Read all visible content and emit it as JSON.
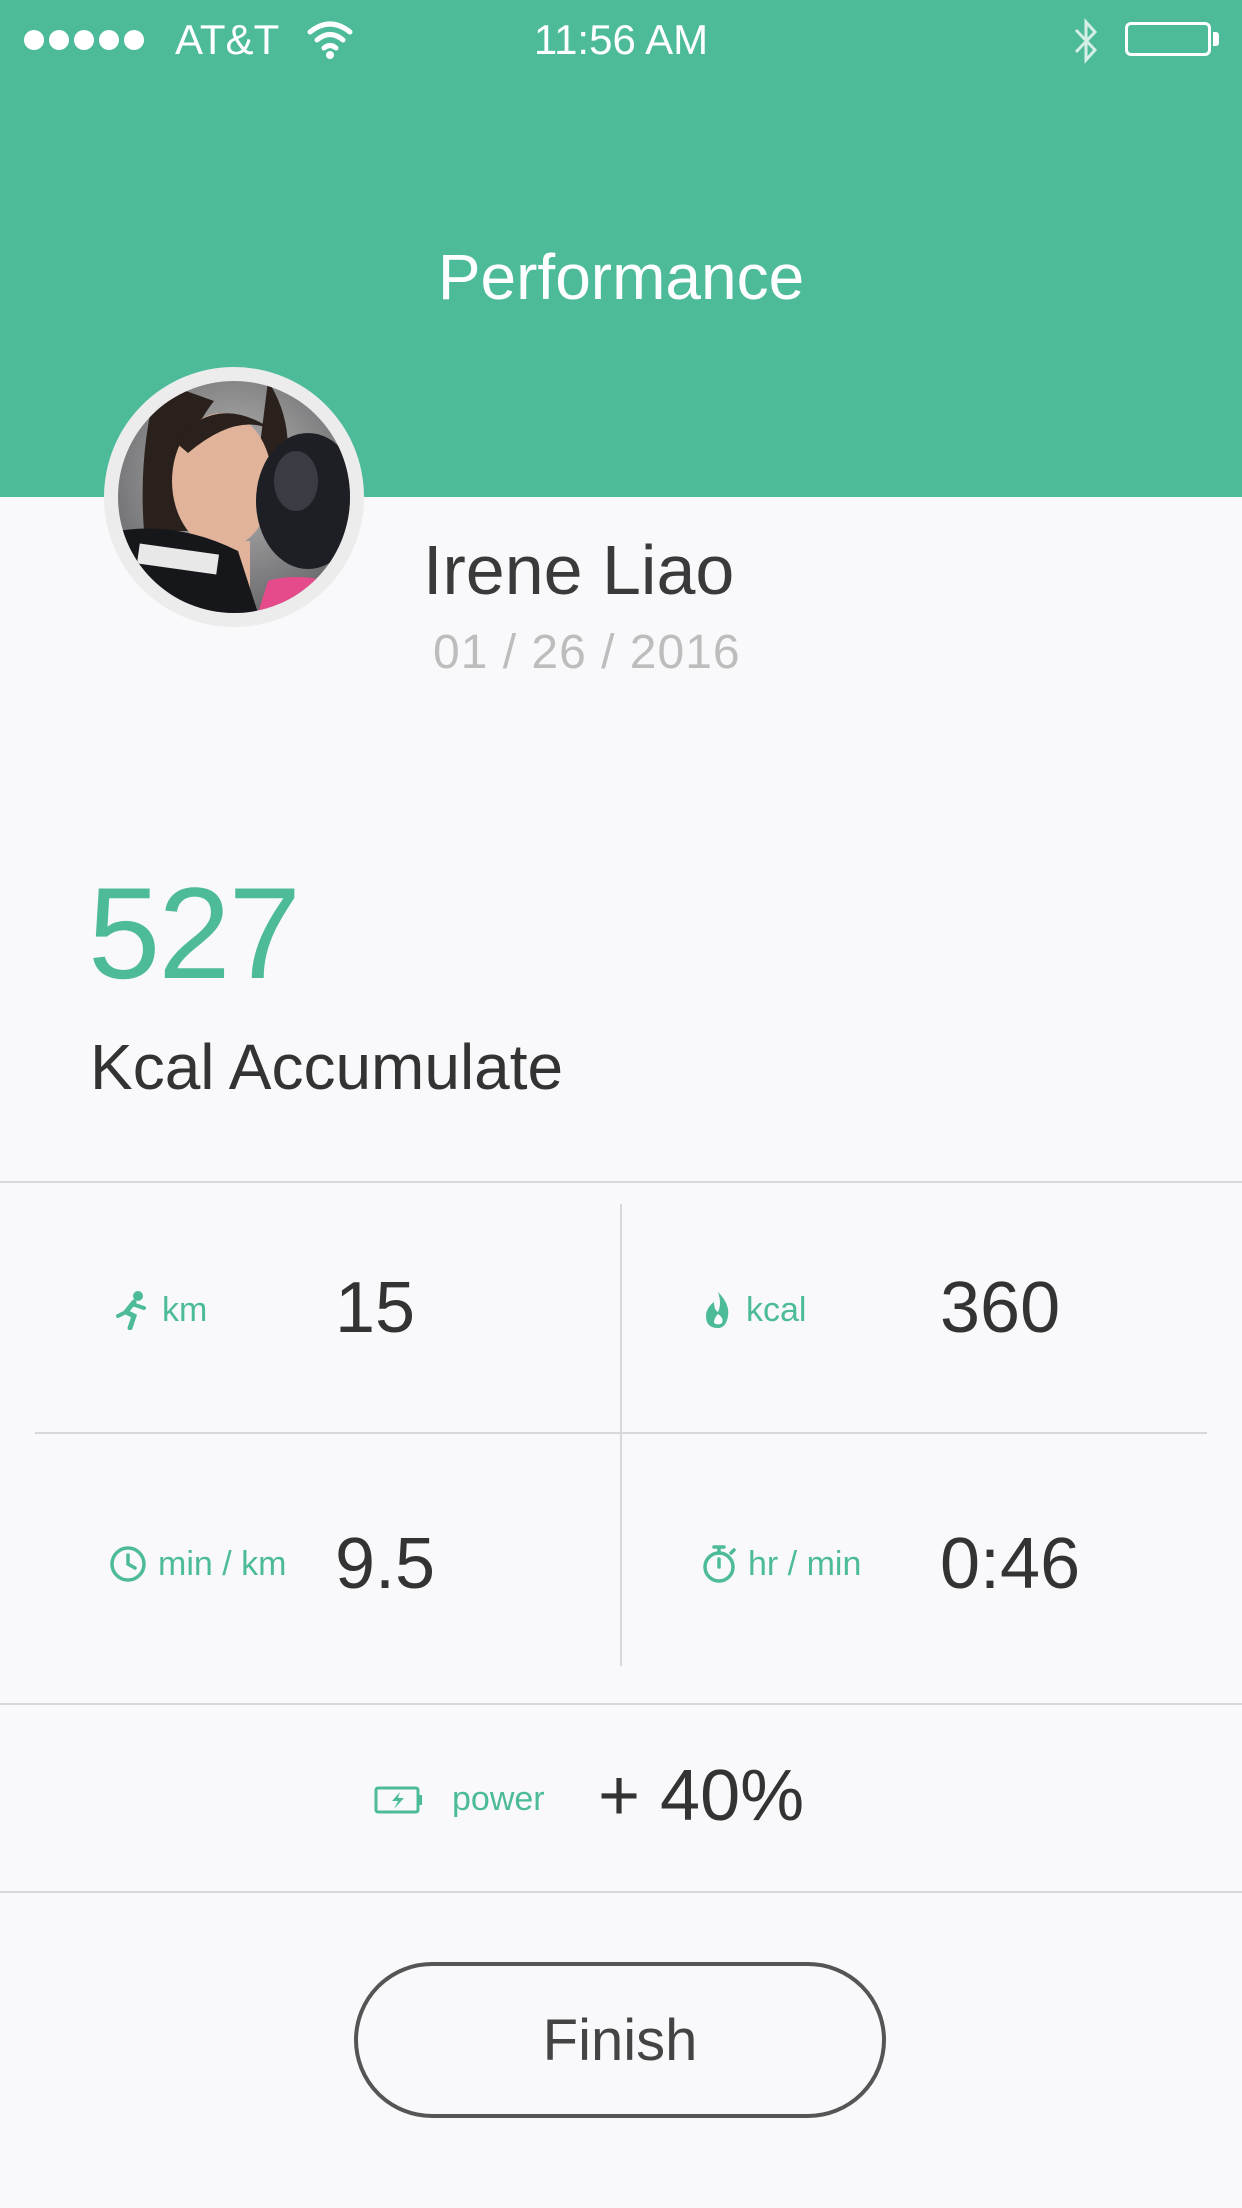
{
  "status_bar": {
    "carrier": "AT&T",
    "time": "11:56 AM"
  },
  "header": {
    "title": "Performance"
  },
  "profile": {
    "name": "Irene Liao",
    "date": "01 / 26 / 2016"
  },
  "summary": {
    "kcal_value": "527",
    "kcal_label": "Kcal Accumulate"
  },
  "stats": [
    {
      "icon": "running-icon",
      "unit": "km",
      "value": "15"
    },
    {
      "icon": "flame-icon",
      "unit": "kcal",
      "value": "360"
    },
    {
      "icon": "clock-icon",
      "unit": "min / km",
      "value": "9.5"
    },
    {
      "icon": "stopwatch-icon",
      "unit": "hr / min",
      "value": "0:46"
    }
  ],
  "power": {
    "icon": "battery-charging-icon",
    "label": "power",
    "value": "+ 40%"
  },
  "finish_button": {
    "label": "Finish"
  },
  "colors": {
    "accent": "#4dbb9a",
    "text": "#333333",
    "muted": "#bdbdbd"
  }
}
